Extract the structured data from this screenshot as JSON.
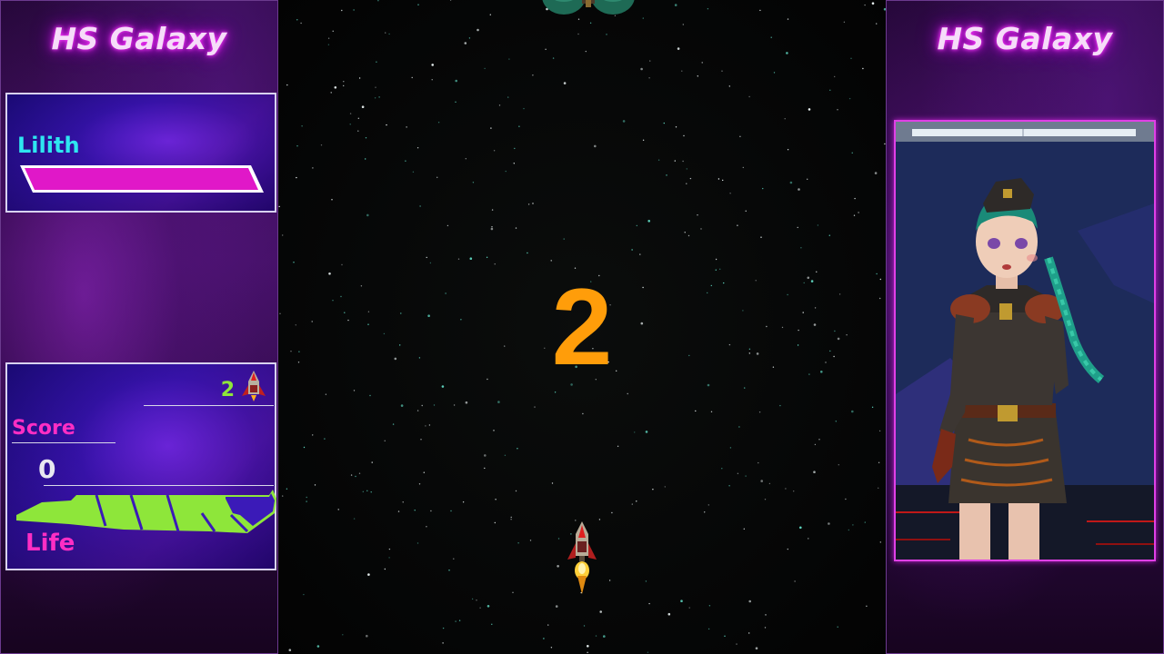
{
  "game": {
    "title": "HS Galaxy",
    "countdown": "2",
    "colors": {
      "accent": "#ff2ec4",
      "life": "#8ee63a",
      "boss_bar": "#e018c8",
      "countdown": "#ff9d0a",
      "boss_name": "#2ee6f0"
    }
  },
  "left_panel": {
    "title": "HS Galaxy",
    "boss": {
      "name": "Lilith",
      "health_fraction": 1.0
    },
    "stats": {
      "lives": "2",
      "lives_icon": "player-ship-icon",
      "score_label": "Score",
      "score_value": "0",
      "life_label": "Life",
      "life_fraction": 1.0
    }
  },
  "right_panel": {
    "title": "HS Galaxy",
    "portrait": "character-portrait"
  }
}
